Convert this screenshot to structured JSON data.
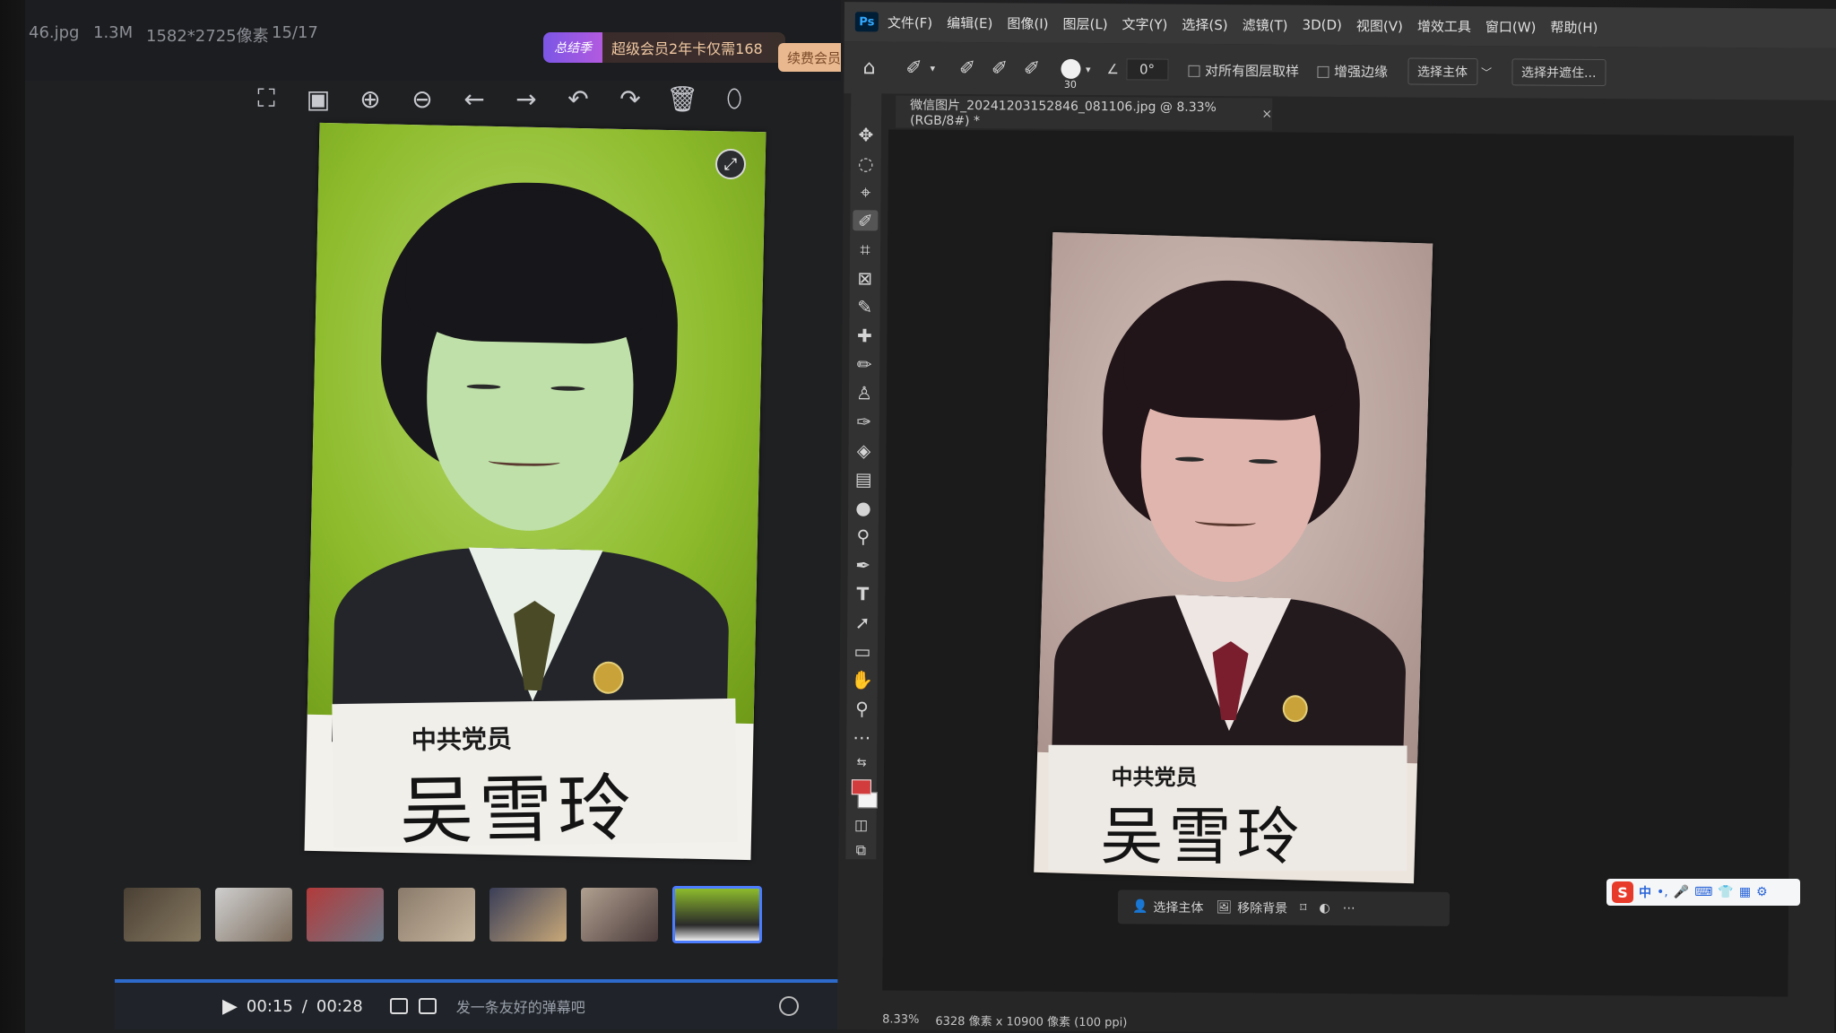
{
  "viewer": {
    "file_suffix": "46.jpg",
    "file_size": "1.3M",
    "dimensions": "1582*2725像素",
    "index": "15/17",
    "promo_tag": "总结季",
    "promo_text": "超级会员2年卡仅需168",
    "renew_label": "续费会员",
    "caption_small": "中共党员",
    "caption_name": "吴雪玲",
    "video": {
      "current_time": "00:15",
      "separator": "/",
      "total_time": "00:28",
      "danmu_placeholder": "发一条友好的弹幕吧"
    },
    "icons": [
      "fullscreen-icon",
      "actual-size-icon",
      "zoom-in-icon",
      "zoom-out-icon",
      "prev-icon",
      "next-icon",
      "rotate-left-icon",
      "rotate-right-icon",
      "delete-icon",
      "more-icon"
    ]
  },
  "photoshop": {
    "logo": "Ps",
    "menu": [
      "文件(F)",
      "编辑(E)",
      "图像(I)",
      "图层(L)",
      "文字(Y)",
      "选择(S)",
      "滤镜(T)",
      "3D(D)",
      "视图(V)",
      "增效工具",
      "窗口(W)",
      "帮助(H)"
    ],
    "options": {
      "brush_size": "30",
      "angle": "0°",
      "sample_all_layers": "对所有图层取样",
      "enhance_edge": "增强边缘",
      "select_subject": "选择主体",
      "select_and_mask": "选择并遮住..."
    },
    "document_tab": "微信图片_20241203152846_081106.jpg @ 8.33%(RGB/8#) *",
    "caption_small": "中共党员",
    "caption_name": "吴雪玲",
    "taskbar": {
      "select_subject": "选择主体",
      "remove_background": "移除背景"
    },
    "status": {
      "zoom": "8.33%",
      "doc_size": "6328 像素 x 10900 像素 (100 ppi)"
    },
    "colors": {
      "foreground": "#d23c3c",
      "background": "#f4f4f4"
    }
  },
  "ime": {
    "logo": "S",
    "mode": "中"
  }
}
